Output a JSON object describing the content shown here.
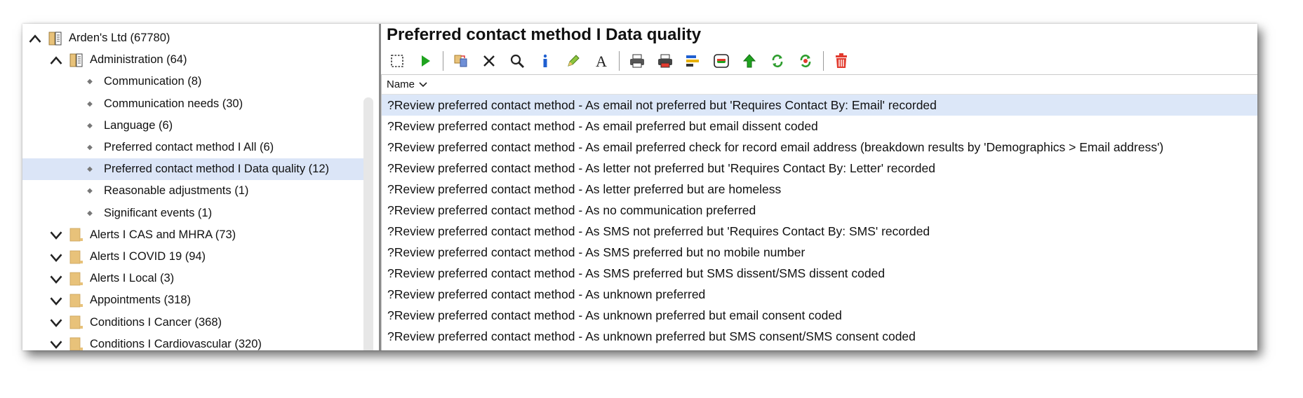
{
  "tree": {
    "items": [
      {
        "label": "Arden's Ltd (67780)",
        "level": 0,
        "expanded": true,
        "icon": "book-icon"
      },
      {
        "label": "Administration (64)",
        "level": 1,
        "expanded": true,
        "icon": "book-icon"
      },
      {
        "label": "Communication (8)",
        "level": 2,
        "icon": "bullet-icon"
      },
      {
        "label": "Communication needs (30)",
        "level": 2,
        "icon": "bullet-icon"
      },
      {
        "label": "Language (6)",
        "level": 2,
        "icon": "bullet-icon"
      },
      {
        "label": "Preferred contact method I All (6)",
        "level": 2,
        "icon": "bullet-icon"
      },
      {
        "label": "Preferred contact method I Data quality (12)",
        "level": 2,
        "icon": "bullet-icon",
        "selected": true
      },
      {
        "label": "Reasonable adjustments (1)",
        "level": 2,
        "icon": "bullet-icon"
      },
      {
        "label": "Significant events (1)",
        "level": 2,
        "icon": "bullet-icon"
      },
      {
        "label": "Alerts I CAS and MHRA (73)",
        "level": 1,
        "expanded": false,
        "icon": "folder-icon"
      },
      {
        "label": "Alerts I COVID 19 (94)",
        "level": 1,
        "expanded": false,
        "icon": "folder-icon"
      },
      {
        "label": "Alerts I Local (3)",
        "level": 1,
        "expanded": false,
        "icon": "folder-icon"
      },
      {
        "label": "Appointments (318)",
        "level": 1,
        "expanded": false,
        "icon": "folder-icon"
      },
      {
        "label": "Conditions I Cancer (368)",
        "level": 1,
        "expanded": false,
        "icon": "folder-icon"
      },
      {
        "label": "Conditions I Cardiovascular (320)",
        "level": 1,
        "expanded": false,
        "icon": "folder-icon"
      }
    ]
  },
  "main": {
    "title": "Preferred contact method I Data quality",
    "toolbar": [
      "select-icon",
      "run-icon",
      "|",
      "duplicate-icon",
      "delete-icon",
      "search-icon",
      "info-icon",
      "edit-icon",
      "font-icon",
      "|",
      "print-icon",
      "print-red-icon",
      "report-icon",
      "export-icon",
      "move-up-icon",
      "refresh-icon",
      "refresh-selected-icon",
      "|",
      "trash-icon"
    ],
    "column_header": "Name",
    "rows": [
      "?Review preferred contact method - As email not preferred but 'Requires Contact By: Email' recorded",
      "?Review preferred contact method - As email preferred but email dissent coded",
      "?Review preferred contact method - As email preferred check for record email address (breakdown results by 'Demographics > Email address')",
      "?Review preferred contact method - As letter not preferred but 'Requires Contact By: Letter' recorded",
      "?Review preferred contact method - As letter preferred but are homeless",
      "?Review preferred contact method - As no communication preferred",
      "?Review preferred contact method - As SMS not preferred but 'Requires Contact By: SMS' recorded",
      "?Review preferred contact method - As SMS preferred but no mobile number",
      "?Review preferred contact method - As SMS preferred but SMS dissent/SMS dissent coded",
      "?Review preferred contact method - As unknown preferred",
      "?Review preferred contact method - As unknown preferred but email consent coded",
      "?Review preferred contact method - As unknown preferred but SMS consent/SMS consent coded"
    ],
    "selected_row": 0
  },
  "colors": {
    "selection": "#dce7f8",
    "run_green": "#1fa31f",
    "delete_red": "#e23a2e",
    "folder": "#e8c27a"
  }
}
